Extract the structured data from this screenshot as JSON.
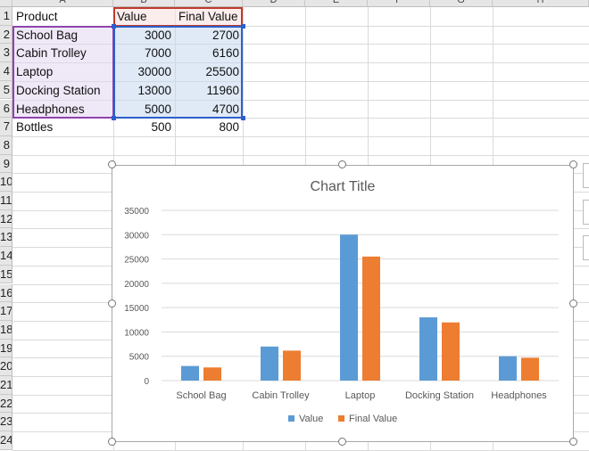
{
  "columns": [
    "A",
    "B",
    "C",
    "D",
    "E",
    "F",
    "G",
    "H"
  ],
  "rows": [
    "1",
    "2",
    "3",
    "4",
    "5",
    "6",
    "7",
    "8",
    "9",
    "10",
    "11",
    "12",
    "13",
    "14",
    "15",
    "16",
    "17",
    "18",
    "19",
    "20",
    "21",
    "22",
    "23",
    "24"
  ],
  "table": {
    "headers": [
      "Product",
      "Value",
      "Final Value"
    ],
    "data": [
      [
        "School Bag",
        "3000",
        "2700"
      ],
      [
        "Cabin Trolley",
        "7000",
        "6160"
      ],
      [
        "Laptop",
        "30000",
        "25500"
      ],
      [
        "Docking Station",
        "13000",
        "11960"
      ],
      [
        "Headphones",
        "5000",
        "4700"
      ],
      [
        "Bottles",
        "500",
        "800"
      ]
    ]
  },
  "colors": {
    "series_value": "#5b9bd5",
    "series_final": "#ed7d31",
    "selection_blue": "#2e5fc9",
    "selection_red": "#c0392b",
    "selection_purple": "#8e44ad"
  },
  "chart_data": {
    "type": "bar",
    "title": "Chart Title",
    "categories": [
      "School Bag",
      "Cabin Trolley",
      "Laptop",
      "Docking Station",
      "Headphones"
    ],
    "series": [
      {
        "name": "Value",
        "values": [
          3000,
          7000,
          30000,
          13000,
          5000
        ]
      },
      {
        "name": "Final Value",
        "values": [
          2700,
          6160,
          25500,
          11960,
          4700
        ]
      }
    ],
    "yticks": [
      "0",
      "5000",
      "10000",
      "15000",
      "20000",
      "25000",
      "30000",
      "35000"
    ],
    "ylim": [
      0,
      35000
    ],
    "grid": true,
    "legend": "bottom"
  }
}
